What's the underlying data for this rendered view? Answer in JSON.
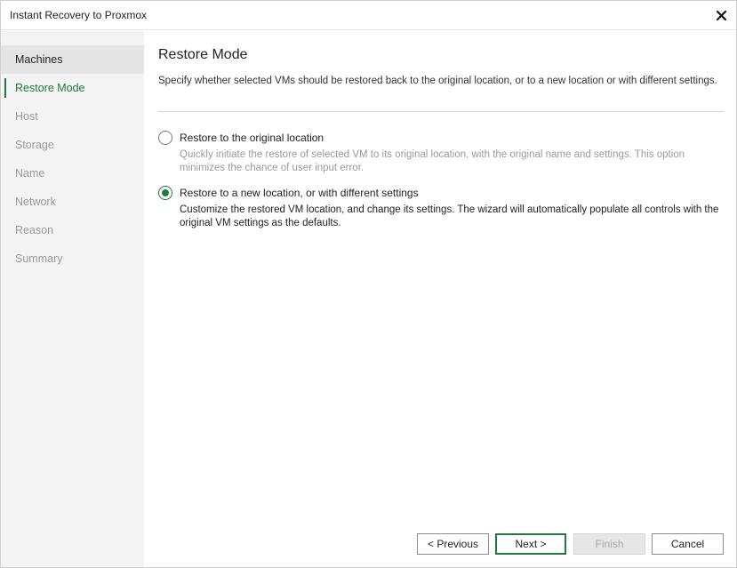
{
  "window": {
    "title": "Instant Recovery to Proxmox",
    "close_icon": "close-icon"
  },
  "sidebar": {
    "items": [
      {
        "label": "Machines",
        "state": "visited"
      },
      {
        "label": "Restore Mode",
        "state": "active"
      },
      {
        "label": "Host",
        "state": "pending"
      },
      {
        "label": "Storage",
        "state": "pending"
      },
      {
        "label": "Name",
        "state": "pending"
      },
      {
        "label": "Network",
        "state": "pending"
      },
      {
        "label": "Reason",
        "state": "pending"
      },
      {
        "label": "Summary",
        "state": "pending"
      }
    ]
  },
  "main": {
    "title": "Restore Mode",
    "description": "Specify whether selected VMs should be restored back to the original location, or to a new location or with different settings.",
    "options": [
      {
        "label": "Restore to the original location",
        "description": "Quickly initiate the restore of selected VM to its original location, with the original name and settings. This option minimizes the chance of user input error.",
        "selected": false
      },
      {
        "label": "Restore to a new location, or with different settings",
        "description": "Customize the restored VM location, and change its settings. The wizard will automatically populate all controls with the original VM settings as the defaults.",
        "selected": true
      }
    ]
  },
  "buttons": {
    "previous": "< Previous",
    "next": "Next >",
    "finish": "Finish",
    "cancel": "Cancel"
  },
  "colors": {
    "accent": "#1e7b3c",
    "sidebar_bg": "#f3f3f3",
    "disabled_text": "#9a9a9a"
  }
}
